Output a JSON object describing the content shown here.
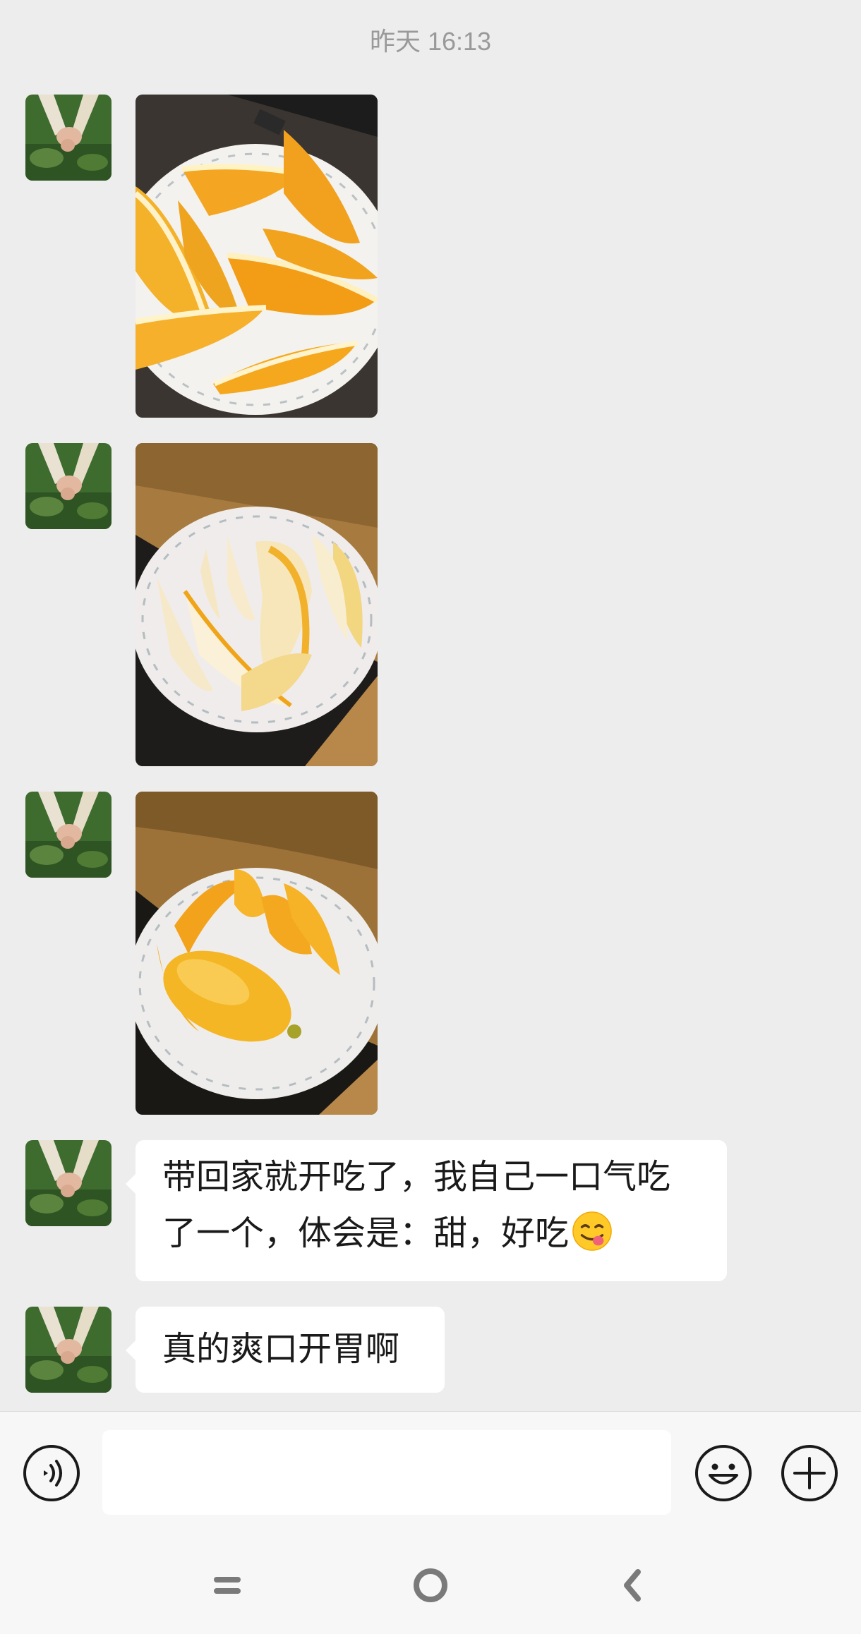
{
  "chat": {
    "timestamp": "昨天 16:13",
    "messages": [
      {
        "type": "image",
        "sender": "contact",
        "content": "sliced oranges on a plate"
      },
      {
        "type": "image",
        "sender": "contact",
        "content": "orange peels on a plate"
      },
      {
        "type": "image",
        "sender": "contact",
        "content": "peeled orange on a plate"
      },
      {
        "type": "text",
        "sender": "contact",
        "lines": [
          "带回家就开吃了，我自己一口气吃",
          "了一个，体会是：甜，好吃"
        ],
        "emoji": "face-savoring-food"
      },
      {
        "type": "text",
        "sender": "contact",
        "lines": [
          "真的爽口开胃啊"
        ]
      }
    ]
  },
  "input_bar": {
    "value": "",
    "voice_icon": "voice-icon",
    "emoji_icon": "emoji-icon",
    "more_icon": "plus-icon"
  },
  "nav_bar": {
    "icons": [
      "menu-icon",
      "home-icon",
      "back-icon"
    ]
  },
  "colors": {
    "chat_background": "#ededed",
    "bubble": "#ffffff",
    "timestamp_text": "#999999",
    "bar_background": "#f7f7f7"
  }
}
